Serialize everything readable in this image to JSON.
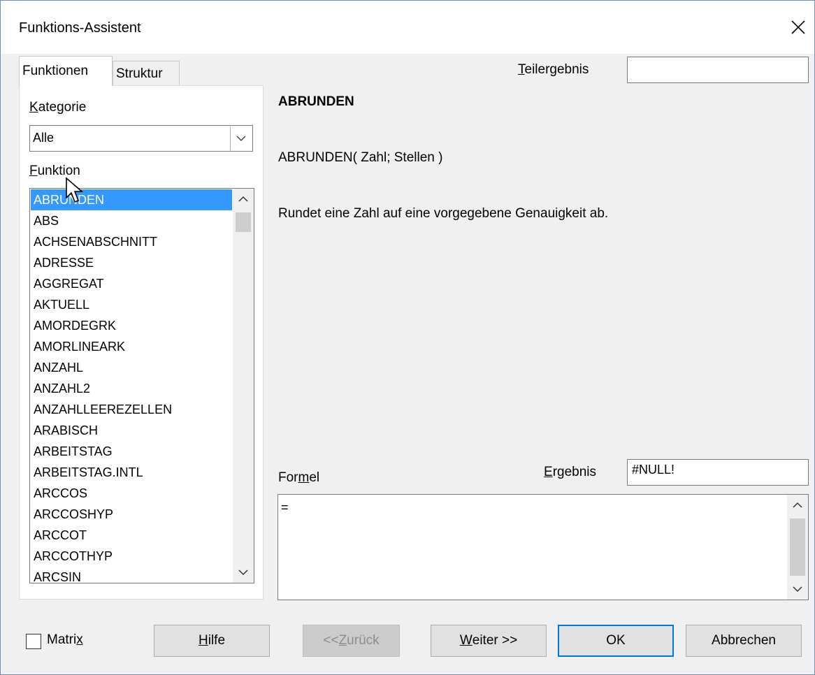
{
  "window": {
    "title": "Funktions-Assistent"
  },
  "tabs": [
    {
      "label": "Funktionen",
      "active": true
    },
    {
      "label": "Struktur",
      "active": false
    }
  ],
  "category": {
    "label_accel": "K",
    "label_rest": "ategorie",
    "selected": "Alle"
  },
  "function_list": {
    "label_accel": "F",
    "label_rest": "unktion",
    "selected_index": 0,
    "items": [
      "ABRUNDEN",
      "ABS",
      "ACHSENABSCHNITT",
      "ADRESSE",
      "AGGREGAT",
      "AKTUELL",
      "AMORDEGRK",
      "AMORLINEARK",
      "ANZAHL",
      "ANZAHL2",
      "ANZAHLLEEREZELLEN",
      "ARABISCH",
      "ARBEITSTAG",
      "ARBEITSTAG.INTL",
      "ARCCOS",
      "ARCCOSHYP",
      "ARCCOT",
      "ARCCOTHYP",
      "ARCSIN"
    ]
  },
  "teilergebnis": {
    "label_accel": "T",
    "label_rest": "eilergebnis",
    "value": ""
  },
  "details": {
    "function_name": "ABRUNDEN",
    "syntax": "ABRUNDEN( Zahl; Stellen )",
    "description": "Rundet eine Zahl auf eine vorgegebene Genauigkeit ab."
  },
  "formula": {
    "label_pre": "For",
    "label_accel": "m",
    "label_post": "el",
    "value": "="
  },
  "result": {
    "label_accel": "E",
    "label_rest": "rgebnis",
    "value": "#NULL!"
  },
  "matrix": {
    "label_pre": "Matri",
    "label_accel": "x",
    "checked": false
  },
  "buttons": {
    "help": {
      "accel": "H",
      "rest": "ilfe"
    },
    "back": {
      "pre": "<< ",
      "accel": "Z",
      "rest": "urück",
      "enabled": false
    },
    "next": {
      "accel": "W",
      "rest": "eiter >>"
    },
    "ok": "OK",
    "cancel": "Abbrechen"
  }
}
